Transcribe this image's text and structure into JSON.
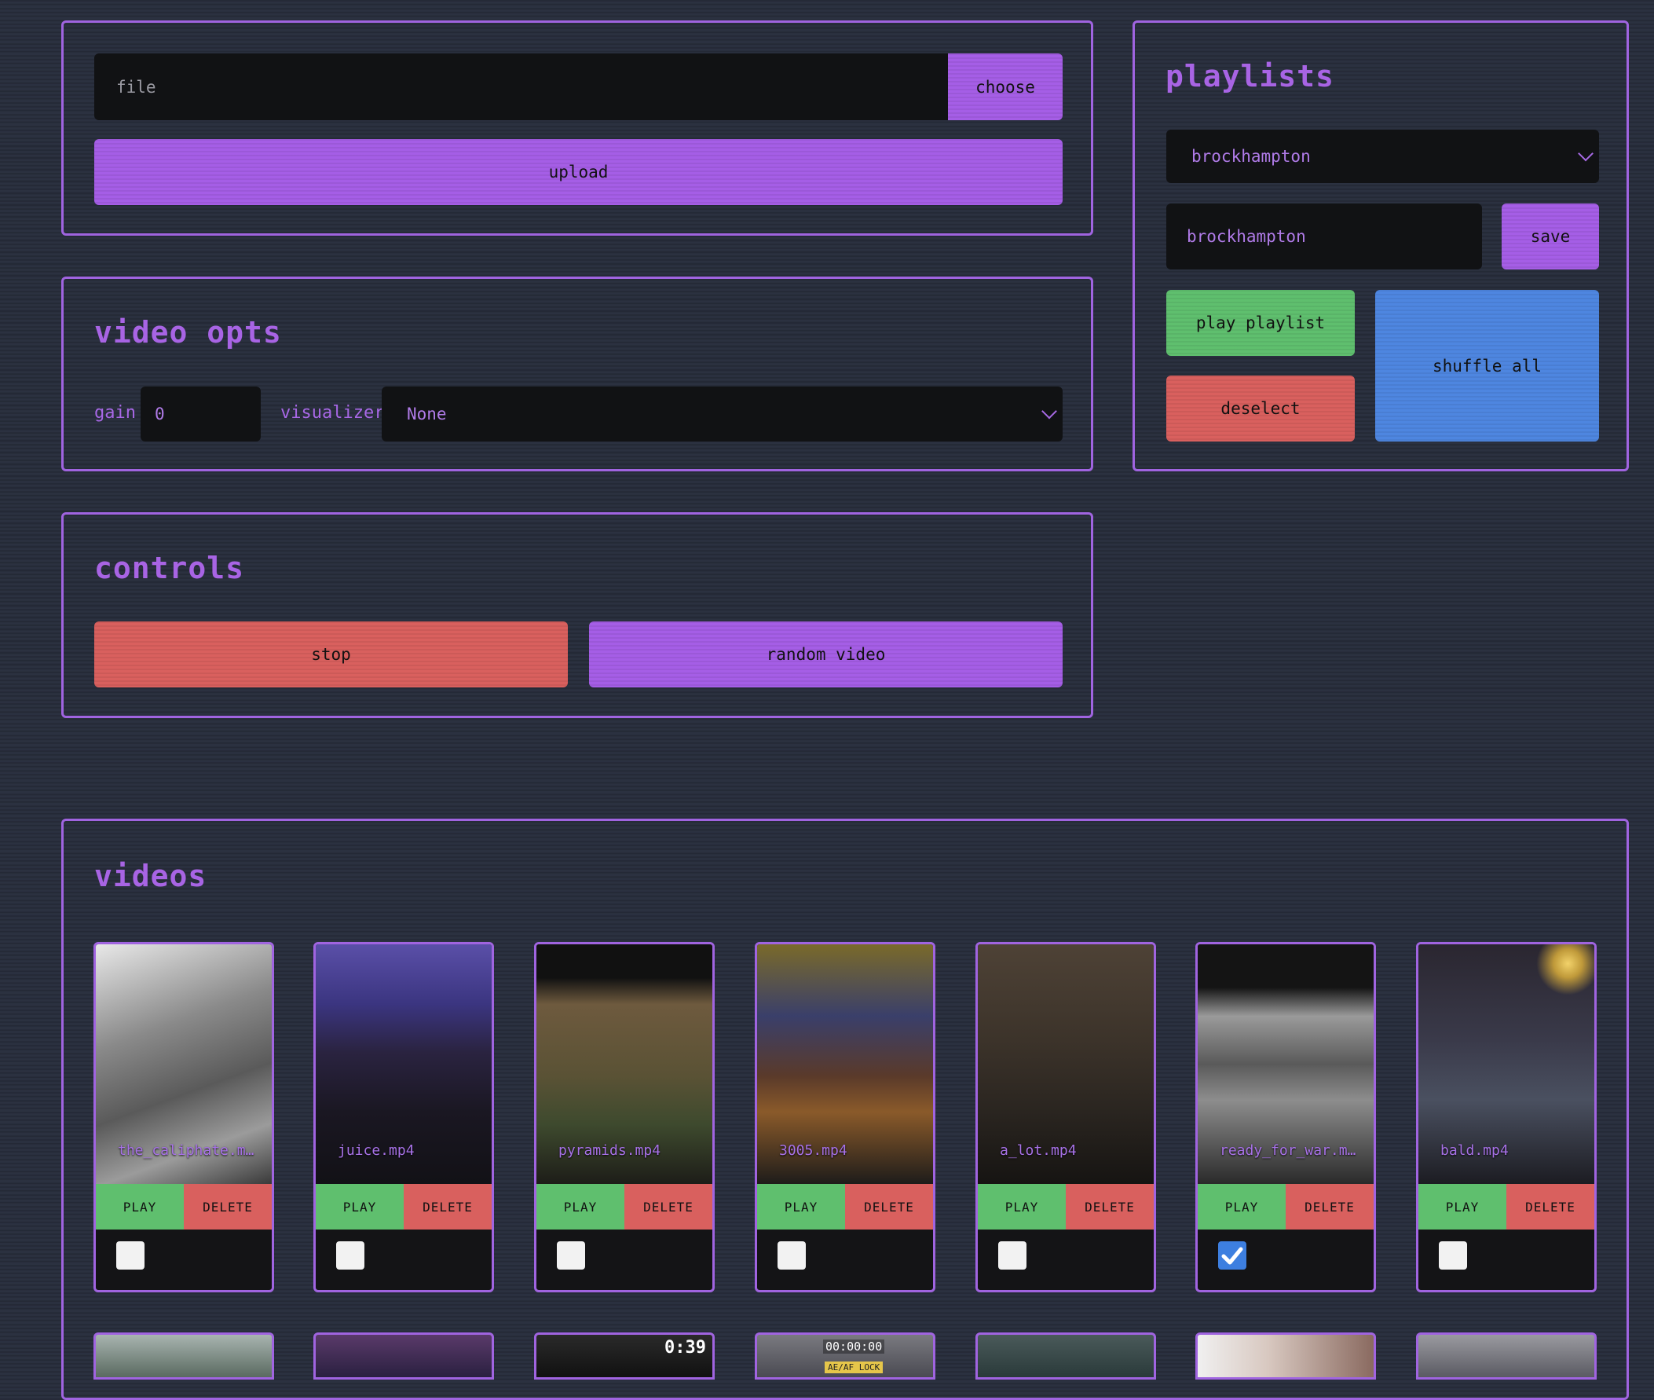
{
  "upload": {
    "file_placeholder": "file",
    "choose_label": "choose",
    "upload_label": "upload"
  },
  "video_opts": {
    "title": "video opts",
    "gain_label": "gain",
    "gain_value": "0",
    "visualizer_label": "visualizer",
    "visualizer_value": "None"
  },
  "controls": {
    "title": "controls",
    "stop_label": "stop",
    "random_label": "random video"
  },
  "playlists": {
    "title": "playlists",
    "selected": "brockhampton",
    "name_value": "brockhampton",
    "save_label": "save",
    "play_label": "play playlist",
    "shuffle_label": "shuffle all",
    "deselect_label": "deselect"
  },
  "videos": {
    "title": "videos",
    "play_label": "PLAY",
    "delete_label": "DELETE",
    "items": [
      {
        "name": "the_caliphate.m…",
        "checked": false
      },
      {
        "name": "juice.mp4",
        "checked": false
      },
      {
        "name": "pyramids.mp4",
        "checked": false
      },
      {
        "name": "3005.mp4",
        "checked": false
      },
      {
        "name": "a_lot.mp4",
        "checked": false
      },
      {
        "name": "ready_for_war.m…",
        "checked": true
      },
      {
        "name": "bald.mp4",
        "checked": false
      }
    ],
    "peek_overlay": [
      "0:39",
      "00:00:00",
      "AE/AF LOCK"
    ]
  },
  "colors": {
    "accent": "#a55ee6",
    "play": "#5fbf6e",
    "danger": "#d9605e",
    "info": "#4e86e0",
    "background": "#2b3140"
  }
}
